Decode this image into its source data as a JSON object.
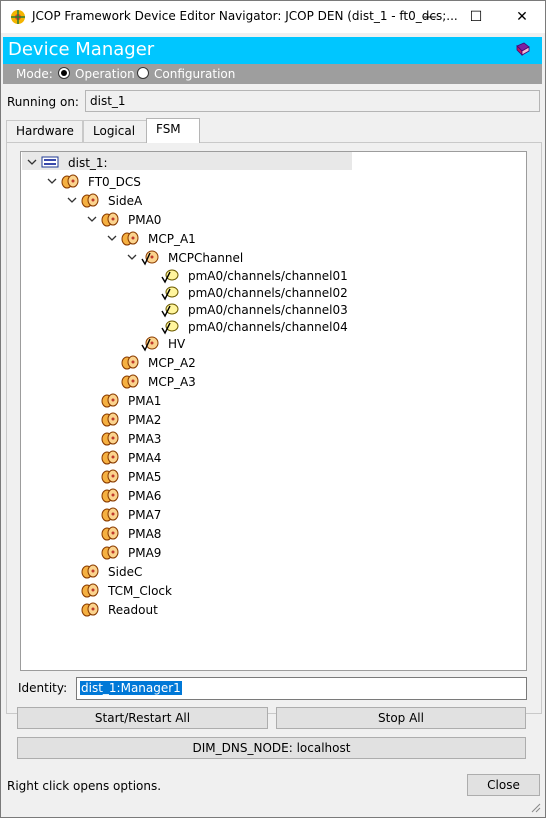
{
  "window": {
    "title": "JCOP Framework Device Editor Navigator: JCOP DEN (dist_1 - ft0_dcs;...",
    "minimize_glyph": "—",
    "maximize_glyph": "☐",
    "close_glyph": "✕"
  },
  "header": {
    "title": "Device Manager",
    "accent_color": "#00c6ff"
  },
  "mode": {
    "label": "Mode:",
    "options": [
      "Operation",
      "Configuration"
    ],
    "selected": "Operation"
  },
  "running": {
    "label": "Running on:",
    "value": "dist_1"
  },
  "tabs": [
    {
      "label": "Hardware"
    },
    {
      "label": "Logical"
    },
    {
      "label": "FSM"
    }
  ],
  "active_tab": "FSM",
  "tree": {
    "nodes": [
      {
        "label": "dist_1:",
        "icon": "system-icon",
        "expanded": true
      },
      {
        "label": "FT0_DCS",
        "icon": "fsm-node-icon",
        "expanded": true
      },
      {
        "label": "SideA",
        "icon": "fsm-node-icon",
        "expanded": true
      },
      {
        "label": "PMA0",
        "icon": "fsm-node-icon",
        "expanded": true
      },
      {
        "label": "MCP_A1",
        "icon": "fsm-node-icon",
        "expanded": true
      },
      {
        "label": "MCPChannel",
        "icon": "fsm-node-checked-icon",
        "expanded": true
      },
      {
        "label": "pmA0/channels/channel01",
        "icon": "fsm-device-icon"
      },
      {
        "label": "pmA0/channels/channel02",
        "icon": "fsm-device-icon"
      },
      {
        "label": "pmA0/channels/channel03",
        "icon": "fsm-device-icon"
      },
      {
        "label": "pmA0/channels/channel04",
        "icon": "fsm-device-icon"
      },
      {
        "label": "HV",
        "icon": "fsm-node-checked-icon"
      },
      {
        "label": "MCP_A2",
        "icon": "fsm-node-icon"
      },
      {
        "label": "MCP_A3",
        "icon": "fsm-node-icon"
      },
      {
        "label": "PMA1",
        "icon": "fsm-node-icon"
      },
      {
        "label": "PMA2",
        "icon": "fsm-node-icon"
      },
      {
        "label": "PMA3",
        "icon": "fsm-node-icon"
      },
      {
        "label": "PMA4",
        "icon": "fsm-node-icon"
      },
      {
        "label": "PMA5",
        "icon": "fsm-node-icon"
      },
      {
        "label": "PMA6",
        "icon": "fsm-node-icon"
      },
      {
        "label": "PMA7",
        "icon": "fsm-node-icon"
      },
      {
        "label": "PMA8",
        "icon": "fsm-node-icon"
      },
      {
        "label": "PMA9",
        "icon": "fsm-node-icon"
      },
      {
        "label": "SideC",
        "icon": "fsm-node-icon"
      },
      {
        "label": "TCM_Clock",
        "icon": "fsm-node-icon"
      },
      {
        "label": "Readout",
        "icon": "fsm-node-icon"
      }
    ]
  },
  "identity": {
    "label": "Identity:",
    "value": "dist_1:Manager1"
  },
  "buttons": {
    "start": "Start/Restart All",
    "stop": "Stop All",
    "dns": "DIM_DNS_NODE: localhost",
    "close": "Close"
  },
  "status": "Right click opens options."
}
